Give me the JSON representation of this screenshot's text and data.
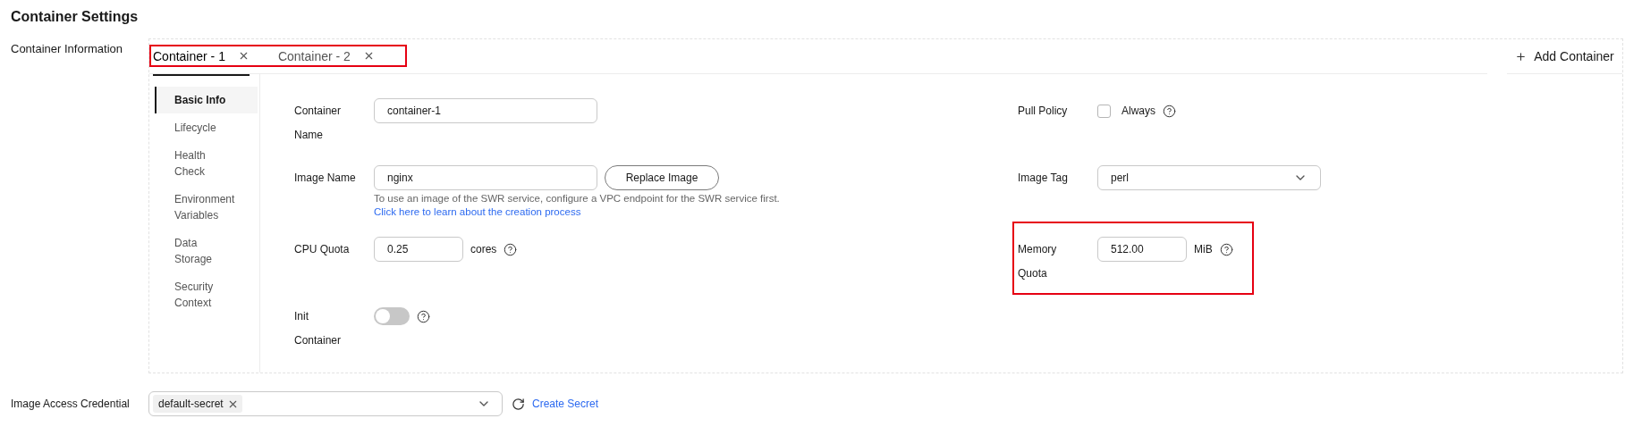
{
  "title": "Container Settings",
  "container_information": {
    "label": "Container Information",
    "tabs_highlighted": true,
    "tabs": [
      {
        "label": "Container - 1",
        "selected": true
      },
      {
        "label": "Container - 2",
        "selected": false
      }
    ],
    "add_button": "Add Container",
    "nav": [
      {
        "label": "Basic Info",
        "selected": true
      },
      {
        "label": "Lifecycle",
        "selected": false
      },
      {
        "label": "Health Check",
        "selected": false
      },
      {
        "label": "Environment Variables",
        "selected": false
      },
      {
        "label": "Data Storage",
        "selected": false
      },
      {
        "label": "Security Context",
        "selected": false
      }
    ],
    "rows": [
      {
        "left": {
          "kind": "text",
          "label": "Container Name",
          "value": "container-1"
        },
        "right": {
          "kind": "checkbox",
          "label": "Pull Policy",
          "option": "Always",
          "checked": false,
          "help": true
        }
      },
      {
        "left": {
          "kind": "text_button",
          "label": "Image Name",
          "value": "nginx",
          "button": "Replace Image",
          "hint": "To use an image of the SWR service, configure a VPC endpoint for the SWR service first.",
          "hint_link": "Click here to learn about the creation process"
        },
        "right": {
          "kind": "select",
          "label": "Image Tag",
          "value": "perl"
        }
      },
      {
        "left": {
          "kind": "number",
          "label": "CPU Quota",
          "value": "0.25",
          "unit": "cores",
          "help": true
        },
        "right": {
          "kind": "number",
          "label": "Memory Quota",
          "value": "512.00",
          "unit": "MiB",
          "help": true,
          "highlighted": true
        }
      },
      {
        "left": {
          "kind": "toggle",
          "label": "Init Container",
          "on": false,
          "help": true
        }
      }
    ]
  },
  "credential": {
    "label": "Image Access Credential",
    "tags": [
      "default-secret"
    ],
    "link": "Create Secret"
  }
}
